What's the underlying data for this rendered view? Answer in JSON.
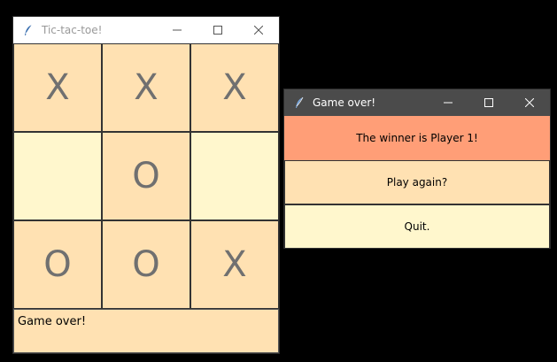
{
  "main_window": {
    "title": "Tic-tac-toe!",
    "icon": "feather-icon",
    "controls": [
      "minimize-icon",
      "maximize-icon",
      "close-icon"
    ],
    "board": [
      {
        "mark": "X",
        "color": "#ffe1b2"
      },
      {
        "mark": "X",
        "color": "#ffe1b2"
      },
      {
        "mark": "X",
        "color": "#ffe1b2"
      },
      {
        "mark": "",
        "color": "#fff7cd"
      },
      {
        "mark": "O",
        "color": "#ffe1b2"
      },
      {
        "mark": "",
        "color": "#fff7cd"
      },
      {
        "mark": "O",
        "color": "#ffe1b2"
      },
      {
        "mark": "O",
        "color": "#ffe1b2"
      },
      {
        "mark": "X",
        "color": "#ffe1b2"
      }
    ],
    "status": "Game over!"
  },
  "dialog": {
    "title": "Game over!",
    "icon": "feather-icon",
    "controls": [
      "minimize-icon",
      "maximize-icon",
      "close-icon"
    ],
    "message": "The winner is Player 1!",
    "play_again_label": "Play again?",
    "quit_label": "Quit."
  },
  "colors": {
    "cell_orange": "#ffe1b2",
    "cell_yellow": "#fff7cd",
    "message_bg": "#ff9e77",
    "mark": "#707070",
    "active_titlebar": "#4b4b4b"
  }
}
